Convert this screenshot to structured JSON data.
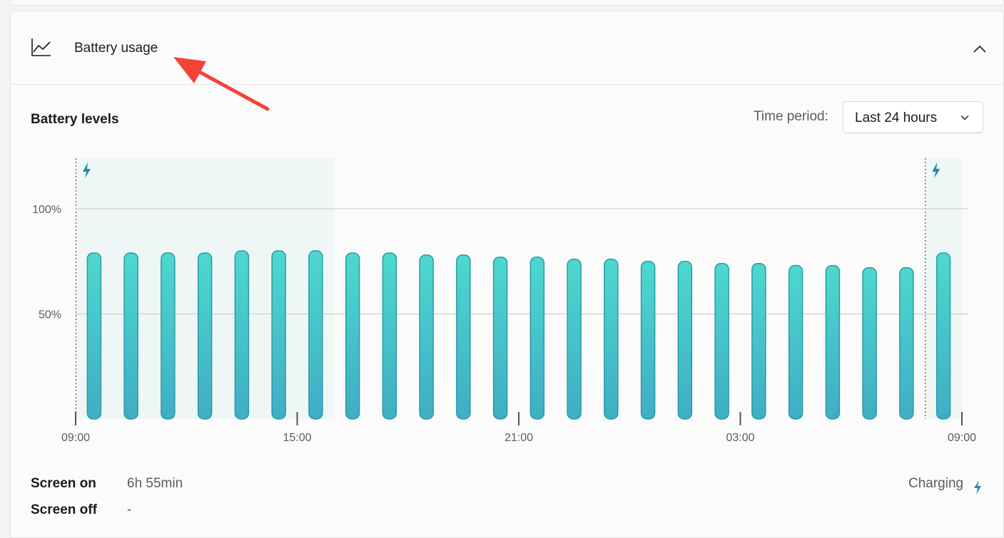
{
  "header": {
    "title": "Battery usage",
    "icon": "line-chart-icon",
    "collapse_icon": "chevron-up-icon"
  },
  "section_title": "Battery levels",
  "time_period": {
    "label": "Time period:",
    "selected": "Last 24 hours",
    "icon": "chevron-down-icon"
  },
  "stats": {
    "screen_on": {
      "label": "Screen on",
      "value": "6h 55min"
    },
    "screen_off": {
      "label": "Screen off",
      "value": "-"
    }
  },
  "legend": {
    "charging_label": "Charging",
    "charging_icon": "lightning-bolt-icon"
  },
  "colors": {
    "bar_top": "#4dd8cf",
    "bar_bottom": "#40adc4",
    "bar_stroke": "#2a9aa8",
    "charging_shade": "#eef7f5",
    "charging_icon": "#1f8fa0",
    "annotation": "#f44336"
  },
  "chart_data": {
    "type": "bar",
    "title": "",
    "xlabel": "",
    "ylabel": "",
    "ylim": [
      0,
      125
    ],
    "y_ticks": [
      {
        "value": 100,
        "label": "100%"
      },
      {
        "value": 50,
        "label": "50%"
      }
    ],
    "x_ticks": [
      "09:00",
      "15:00",
      "21:00",
      "03:00",
      "09:00"
    ],
    "x_range_hours": [
      0,
      24
    ],
    "values": [
      79,
      79,
      79,
      79,
      80,
      80,
      80,
      79,
      79,
      78,
      78,
      77,
      77,
      76,
      76,
      75,
      75,
      74,
      74,
      73,
      73,
      72,
      72,
      79
    ],
    "charging_periods_hours": [
      [
        0,
        7
      ],
      [
        23,
        24
      ]
    ],
    "grid": true,
    "legend": "bottom-right"
  }
}
